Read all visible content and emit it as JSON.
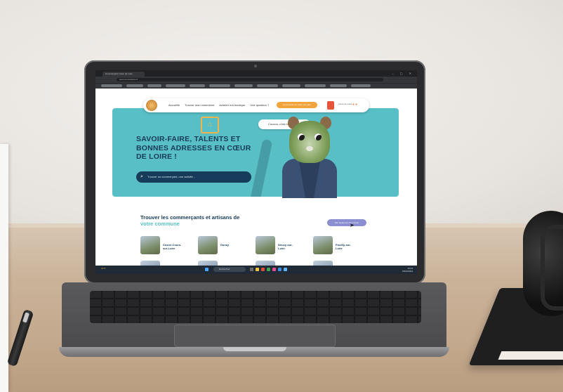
{
  "browser": {
    "tab_title": "Commerçants Cœur de Loire",
    "window_controls": "– ▢ ✕",
    "url": "www.coeurdeloire.fr"
  },
  "site": {
    "nav": {
      "items": [
        "Accueillir",
        "Trouver mon commerce",
        "Acheter ma boutique",
        "Une question ?"
      ],
      "cta": "Commercer en Cœur de Loire",
      "mini_logo_text": "Cœur de Loire"
    },
    "hero": {
      "title": "SAVOIR-FAIRE, TALENTS ET BONNES ADRESSES EN CŒUR DE LOIRE !",
      "search_placeholder": "Trouver un commerçant, une activité...",
      "bubble": "Coucou, c'est moi Oscar !"
    },
    "section": {
      "title_main": "Trouver les commerçants et artisans de",
      "title_accent": "votre commune",
      "button": "Voir toutes les communes"
    },
    "communes": [
      "Cosne-Cours-sur-Loire",
      "Donzy",
      "Neuvy-sur-Loire",
      "Pouilly-sur-Loire"
    ]
  },
  "taskbar": {
    "search": "Rechercher",
    "weather": "13°C",
    "time": "10:24",
    "date": "18/04/2024"
  },
  "colors": {
    "hero_bg": "#58bfc6",
    "brand_navy": "#173b5a",
    "cta_orange": "#f0a43b",
    "section_button": "#8b8fd1"
  }
}
